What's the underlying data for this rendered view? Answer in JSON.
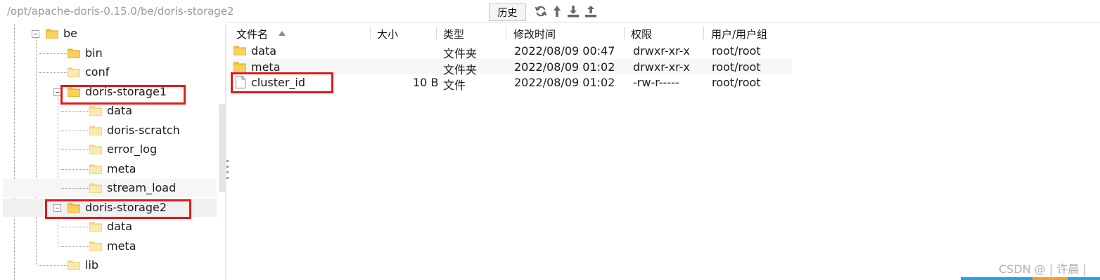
{
  "toolbar": {
    "path": "/opt/apache-doris-0.15.0/be/doris-storage2",
    "history_label": "历史",
    "icons": [
      "refresh-icon",
      "up-icon",
      "download-icon",
      "upload-icon"
    ]
  },
  "tree": {
    "items": [
      {
        "label": "be",
        "state": "expanded"
      },
      {
        "label": "bin"
      },
      {
        "label": "conf"
      },
      {
        "label": "doris-storage1",
        "state": "expanded"
      },
      {
        "label": "data"
      },
      {
        "label": "doris-scratch"
      },
      {
        "label": "error_log"
      },
      {
        "label": "meta"
      },
      {
        "label": "stream_load"
      },
      {
        "label": "doris-storage2",
        "state": "expanded",
        "selected": true
      },
      {
        "label": "data"
      },
      {
        "label": "meta"
      },
      {
        "label": "lib"
      }
    ]
  },
  "file_list": {
    "columns": {
      "name": "文件名",
      "size": "大小",
      "type": "类型",
      "modified": "修改时间",
      "permissions": "权限",
      "owner": "用户/用户组"
    },
    "rows": [
      {
        "name": "data",
        "size": "",
        "type": "文件夹",
        "modified": "2022/08/09 00:47",
        "permissions": "drwxr-xr-x",
        "owner": "root/root",
        "icon": "folder-icon"
      },
      {
        "name": "meta",
        "size": "",
        "type": "文件夹",
        "modified": "2022/08/09 01:02",
        "permissions": "drwxr-xr-x",
        "owner": "root/root",
        "icon": "folder-icon"
      },
      {
        "name": "cluster_id",
        "size": "10 B",
        "type": "文件",
        "modified": "2022/08/09 01:02",
        "permissions": "-rw-r-----",
        "owner": "root/root",
        "icon": "file-icon"
      }
    ]
  },
  "watermark": "CSDN @ | 许晨 |",
  "colors": {
    "highlight_box": "#e01b1b",
    "folder": "#f5c040",
    "strip_blue": "#2aa0dc",
    "strip_orange": "#f0a030"
  }
}
